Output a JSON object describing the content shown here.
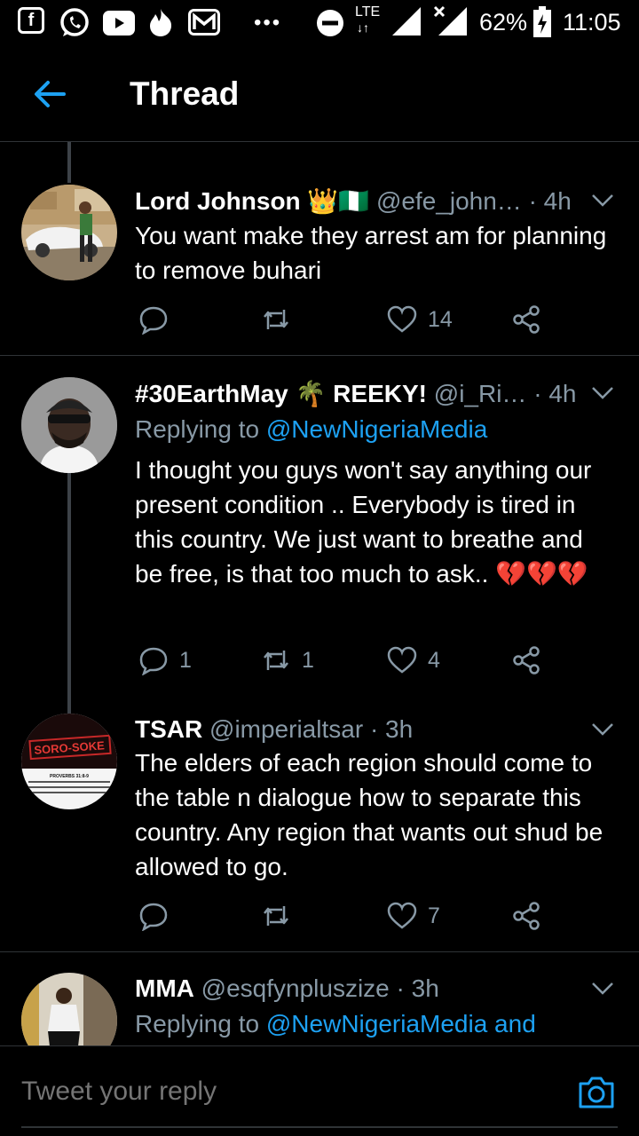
{
  "status_bar": {
    "network": "LTE",
    "battery": "62%",
    "time": "11:05",
    "icons": [
      "flipboard-icon",
      "whatsapp-icon",
      "youtube-icon",
      "tinder-icon",
      "gmail-icon",
      "more-icon",
      "dnd-icon",
      "signal-icon",
      "no-signal-icon",
      "battery-charging-icon"
    ]
  },
  "header": {
    "title": "Thread"
  },
  "tweets": [
    {
      "name": "Lord Johnson 👑🇳🇬",
      "handle": "@efe_john…",
      "time": "· 4h",
      "reply_to_prefix": "",
      "reply_to_link": "",
      "text": "You want make they arrest am for planning to remove buhari",
      "replies": "",
      "retweets": "",
      "likes": "14"
    },
    {
      "name": "#30EarthMay 🌴 REEKY!",
      "handle": "@i_Ri…",
      "time": "· 4h",
      "reply_to_prefix": "Replying to",
      "reply_to_link": "@NewNigeriaMedia",
      "text": "I thought you guys won't say anything our present condition .. Everybody is tired in this country. We just want to breathe and be free, is that too much to ask.. 💔💔💔",
      "replies": "1",
      "retweets": "1",
      "likes": "4"
    },
    {
      "name": "TSAR",
      "handle": "@imperialtsar",
      "time": "· 3h",
      "reply_to_prefix": "",
      "reply_to_link": "",
      "text": "The elders of each region should come to the table n dialogue how to separate this country. Any region that wants out shud be allowed to go.",
      "replies": "",
      "retweets": "",
      "likes": "7",
      "avatar_text": "SORO-SOKE",
      "avatar_subtext": "PROVERBS 31:8-9"
    },
    {
      "name": "MMA",
      "handle": "@esqfynpluszize",
      "time": "· 3h",
      "reply_to_prefix": "Replying to",
      "reply_to_link": "@NewNigeriaMedia and",
      "text": "",
      "replies": "",
      "retweets": "",
      "likes": ""
    }
  ],
  "reply_bar": {
    "placeholder": "Tweet your reply"
  },
  "colors": {
    "background": "#000000",
    "secondary_text": "#8899a6",
    "link": "#1da1f2",
    "divider": "#2f3336"
  }
}
